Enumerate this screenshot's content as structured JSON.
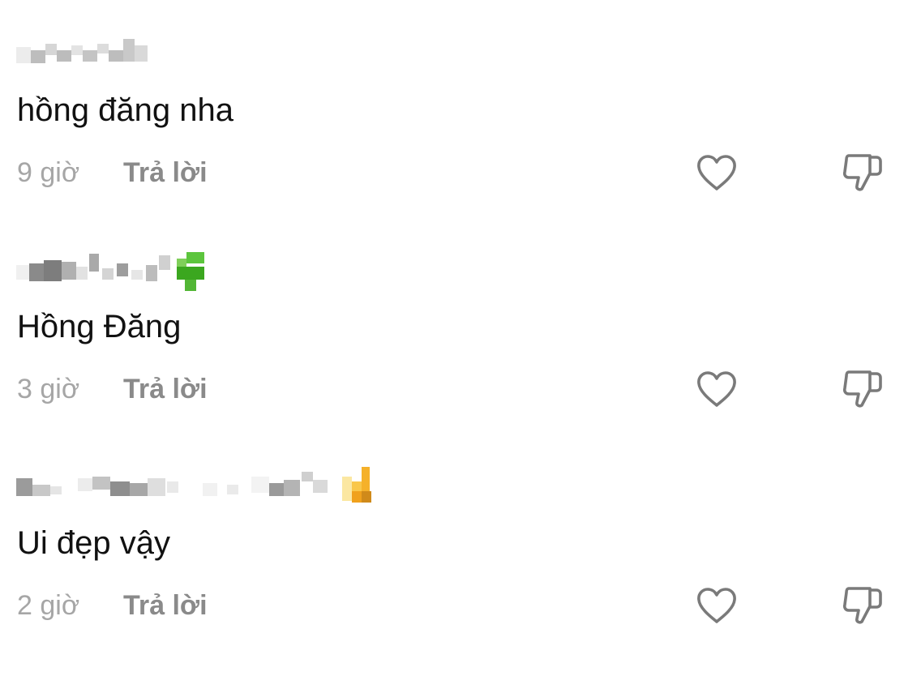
{
  "comments": [
    {
      "text": "hồng đăng nha",
      "time": "9 giờ",
      "reply_label": "Trả lời",
      "like_icon": "heart-icon",
      "dislike_icon": "thumbs-down-icon"
    },
    {
      "text": "Hồng Đăng",
      "time": "3 giờ",
      "reply_label": "Trả lời",
      "like_icon": "heart-icon",
      "dislike_icon": "thumbs-down-icon"
    },
    {
      "text": "Ui đẹp vậy",
      "time": "2 giờ",
      "reply_label": "Trả lời",
      "like_icon": "heart-icon",
      "dislike_icon": "thumbs-down-icon"
    }
  ],
  "colors": {
    "text": "#111111",
    "time": "#a6a6a6",
    "reply": "#8a8a8a",
    "icon": "#7a7a7a"
  }
}
